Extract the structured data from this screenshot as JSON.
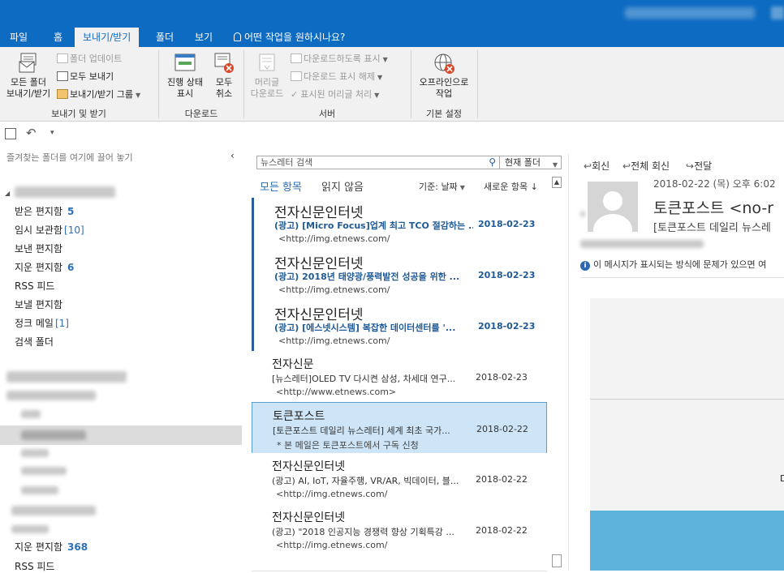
{
  "ribbon_tabs": [
    "파일",
    "홈",
    "보내기/받기",
    "폴더",
    "보기"
  ],
  "tell_me": "어떤 작업을 원하시나요?",
  "ribbon": {
    "send_all": "모든 폴더\n보내기/받기",
    "update_folder": "폴더 업데이트",
    "send_all_small": "모두 보내기",
    "send_receive_groups": "보내기/받기 그룹",
    "group1": "보내기 및 받기",
    "show_progress": "진행 상태\n표시",
    "cancel_all": "모두\n취소",
    "group2": "다운로드",
    "download_headers": "머리글\n다운로드",
    "mark_to_download": "다운로드하도록 표시",
    "unmark_download": "다운로드 표시 해제",
    "process_marked": "표시된 머리글 처리",
    "group3": "서버",
    "work_offline": "오프라인으로\n작업",
    "group4": "기본 설정"
  },
  "folder_pane": {
    "header": "즐겨찾는 폴더를 여기에 끌어 놓기",
    "folders": [
      {
        "name": "받은 편지함",
        "count": "5",
        "style": "bold"
      },
      {
        "name": "임시 보관함",
        "count": "[10]",
        "style": "bracket"
      },
      {
        "name": "보낸 편지함",
        "count": "",
        "style": ""
      },
      {
        "name": "지운 편지함",
        "count": "6",
        "style": "bold"
      },
      {
        "name": "RSS 피드",
        "count": "",
        "style": ""
      },
      {
        "name": "보낼 편지함",
        "count": "",
        "style": ""
      },
      {
        "name": "정크 메일",
        "count": "[1]",
        "style": "bracket"
      },
      {
        "name": "검색 폴더",
        "count": "",
        "style": ""
      }
    ],
    "bottom_folders": [
      {
        "name": "지운 편지함",
        "count": "368"
      },
      {
        "name": "RSS 피드",
        "count": ""
      }
    ]
  },
  "search": {
    "placeholder": "뉴스레터 검색",
    "scope": "현재 폴더"
  },
  "filters": {
    "all": "모든 항목",
    "unread": "읽지 않음",
    "by": "기준: 날짜",
    "order": "새로운 항목 ↓"
  },
  "messages": [
    {
      "sender": "전자신문인터넷",
      "subject": "(광고) [Micro Focus]업계 최고 TCO 절감하는 ...",
      "date": "2018-02-23",
      "preview": "<http://img.etnews.com/",
      "state": "unread"
    },
    {
      "sender": "전자신문인터넷",
      "subject": "(광고) 2018년 태양광/풍력발전 성공을 위한 ...",
      "date": "2018-02-23",
      "preview": "<http://img.etnews.com/",
      "state": "unread"
    },
    {
      "sender": "전자신문인터넷",
      "subject": "(광고) [에스넷시스템] 복잡한 데이터센터를 '...",
      "date": "2018-02-23",
      "preview": "<http://img.etnews.com/",
      "state": "unread"
    },
    {
      "sender": "전자신문",
      "subject": "[뉴스레터]OLED TV 다시켠 삼성, 차세대 연구...",
      "date": "2018-02-23",
      "preview": "<http://www.etnews.com>",
      "state": "read"
    },
    {
      "sender": "토큰포스트",
      "subject": "[토큰포스트 데일리 뉴스레터] 세계 최초 국가...",
      "date": "2018-02-22",
      "preview": "*        본 메일은 토큰포스트에서 구독 신청",
      "state": "selected"
    },
    {
      "sender": "전자신문인터넷",
      "subject": "(광고) AI, IoT, 자율주행, VR/AR, 빅데이터, 블...",
      "date": "2018-02-22",
      "preview": "<http://img.etnews.com/",
      "state": "read"
    },
    {
      "sender": "전자신문인터넷",
      "subject": "(광고) \"2018 인공지능 경쟁력 향상 기획특강 ...",
      "date": "2018-02-22",
      "preview": "<http://img.etnews.com/",
      "state": "read"
    }
  ],
  "reading": {
    "reply": "회신",
    "reply_all": "전체 회신",
    "forward": "전달",
    "date": "2018-02-22 (목) 오후 6:02",
    "from": "토큰포스트 <no-r",
    "subject": "[토큰포스트 데일리 뉴스레",
    "info": "이 메시지가 표시되는 방식에 문제가 있으면 여",
    "body_char": "D"
  }
}
